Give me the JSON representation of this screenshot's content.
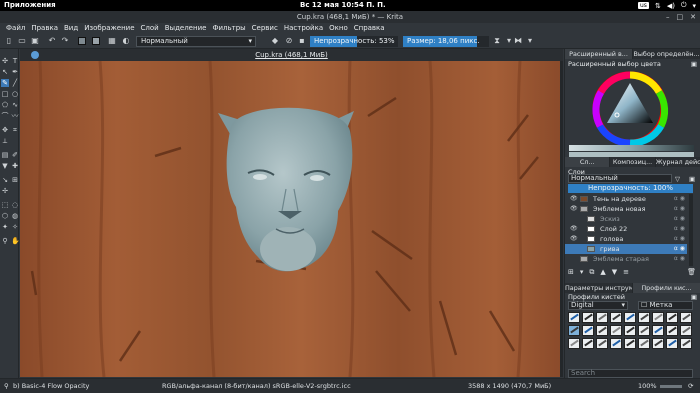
{
  "topbar": {
    "apps_label": "Приложения",
    "clock": "Вс 12 мая    10:54 П. П.",
    "lang": "us",
    "icons": [
      "network-icon",
      "volume-icon",
      "power-icon",
      "chevron-down-icon"
    ]
  },
  "window": {
    "title": "Cup.kra (468,1 МиБ) * — Krita"
  },
  "menu": [
    "Файл",
    "Правка",
    "Вид",
    "Изображение",
    "Слой",
    "Выделение",
    "Фильтры",
    "Сервис",
    "Настройка",
    "Окно",
    "Справка"
  ],
  "toolbar": {
    "blend_mode": "Нормальный",
    "opacity_label": "Непрозрачность: 53%",
    "opacity_value": 53,
    "size_label": "Размер: 18,06 пикс.",
    "fg_color": "#7f8a91",
    "bg_color": "#2b2f33"
  },
  "canvas": {
    "doc_title": "Cup.kra (468,1 МиБ)",
    "wood_color": "#9b5733",
    "head_color": "#8aa3a8"
  },
  "docker": {
    "top_tabs": [
      "Расширенный в...",
      "Выбор определён..."
    ],
    "color_header": "Расширенный выбор цвета",
    "mid_tabs": [
      "Сл...",
      "Композиц...",
      "Журнал действ..."
    ],
    "layers_header": "Слои",
    "blend_mode": "Нормальный",
    "opacity_label": "Непрозрачность:  100%",
    "layers": [
      {
        "name": "Тень на дереве",
        "indent": 1,
        "selected": false,
        "group": false
      },
      {
        "name": "Эмблема новая",
        "indent": 1,
        "selected": false,
        "group": true
      },
      {
        "name": "Эскиз",
        "indent": 2,
        "selected": false,
        "group": false
      },
      {
        "name": "Слой 22",
        "indent": 2,
        "selected": false,
        "group": false
      },
      {
        "name": "голова",
        "indent": 2,
        "selected": false,
        "group": false
      },
      {
        "name": "грива",
        "indent": 2,
        "selected": true,
        "group": false
      },
      {
        "name": "Эмблема старая",
        "indent": 1,
        "selected": false,
        "group": true
      }
    ],
    "bottom_tabs": [
      "Параметры инструме...",
      "Профили кис..."
    ],
    "presets_header": "Профили кистей",
    "presets_filter": "Digital",
    "presets_tag": "Метка",
    "search_placeholder": "Search"
  },
  "status": {
    "brush": "b) Basic-4 Flow Opacity",
    "color_model": "RGB/альфа-канал (8-бит/канал)  sRGB-elle-V2-srgbtrc.icc",
    "dimensions": "3588 x 1490 (470,7 МиБ)",
    "zoom": "100%"
  }
}
